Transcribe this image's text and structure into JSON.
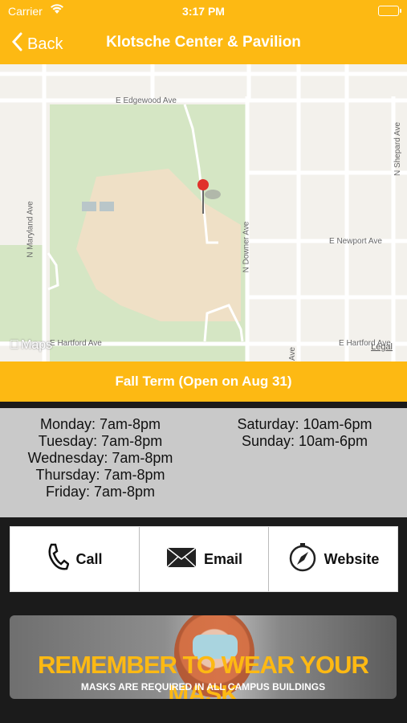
{
  "status": {
    "carrier": "Carrier",
    "time": "3:17 PM"
  },
  "nav": {
    "back_label": "Back",
    "title": "Klotsche Center & Pavilion"
  },
  "map": {
    "maps_logo": "Maps",
    "legal": "Legal",
    "streets": {
      "edgewood": "E Edgewood Ave",
      "maryland": "N Maryland Ave",
      "downer": "N Downer Ave",
      "newport": "E Newport Ave",
      "shepard": "N Shepard Ave",
      "hartford_left": "E Hartford Ave",
      "hartford_right": "E Hartford Ave",
      "ave": "Ave"
    }
  },
  "term_label": "Fall Term (Open on Aug 31)",
  "hours": {
    "left": [
      "Monday: 7am-8pm",
      "Tuesday: 7am-8pm",
      "Wednesday: 7am-8pm",
      "Thursday: 7am-8pm",
      "Friday: 7am-8pm"
    ],
    "right": [
      "Saturday: 10am-6pm",
      "Sunday: 10am-6pm"
    ]
  },
  "actions": {
    "call": "Call",
    "email": "Email",
    "website": "Website"
  },
  "banner": {
    "headline": "REMEMBER TO WEAR YOUR MASK",
    "sub": "MASKS ARE REQUIRED IN ALL CAMPUS BUILDINGS"
  },
  "colors": {
    "brand": "#fdb913"
  }
}
